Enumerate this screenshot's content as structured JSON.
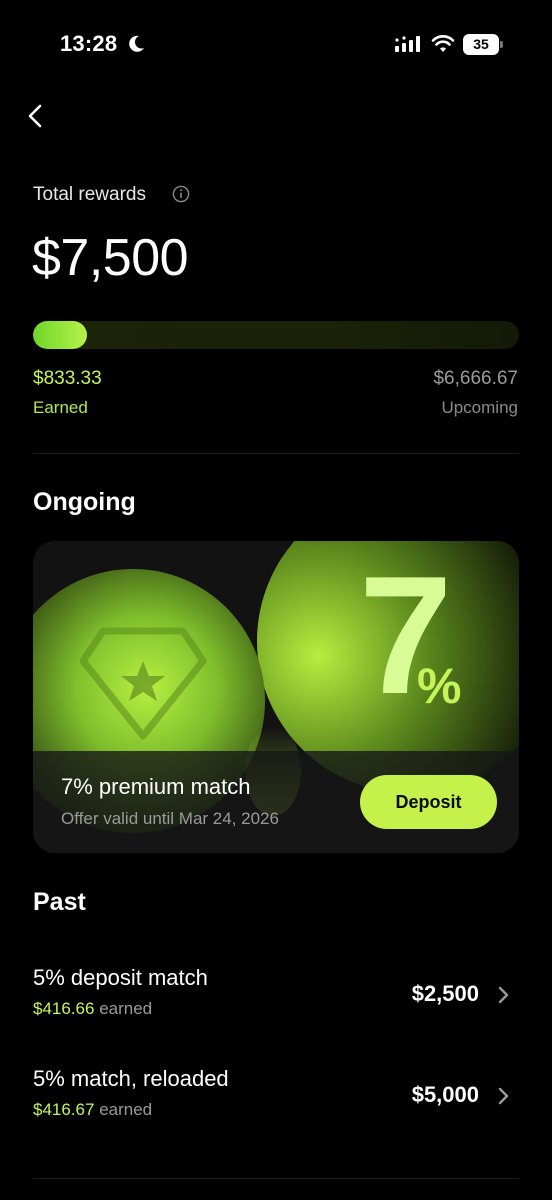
{
  "status_bar": {
    "time": "13:28",
    "battery": "35"
  },
  "summary": {
    "label": "Total rewards",
    "total": "$7,500",
    "earned_value": "$833.33",
    "earned_label": "Earned",
    "upcoming_value": "$6,666.67",
    "upcoming_label": "Upcoming",
    "progress_fraction": 0.111
  },
  "ongoing": {
    "section_title": "Ongoing",
    "promo": {
      "big_number": "7",
      "big_suffix": "%",
      "title": "7% premium match",
      "subtitle": "Offer valid until Mar 24, 2026",
      "button_label": "Deposit"
    }
  },
  "past": {
    "section_title": "Past",
    "items": [
      {
        "name": "5% deposit match",
        "earned_amount": "$416.66",
        "earned_suffix": "earned",
        "amount": "$2,500"
      },
      {
        "name": "5% match, reloaded",
        "earned_amount": "$416.67",
        "earned_suffix": "earned",
        "amount": "$5,000"
      }
    ]
  },
  "colors": {
    "accent": "#c5f24a",
    "earned_green": "#c4f55a",
    "background": "#000000",
    "card": "#141414"
  },
  "icons": [
    "moon-icon",
    "signal-icon",
    "wifi-icon",
    "battery-icon",
    "back-arrow-icon",
    "info-icon",
    "shield-star-icon",
    "chevron-right-icon"
  ]
}
